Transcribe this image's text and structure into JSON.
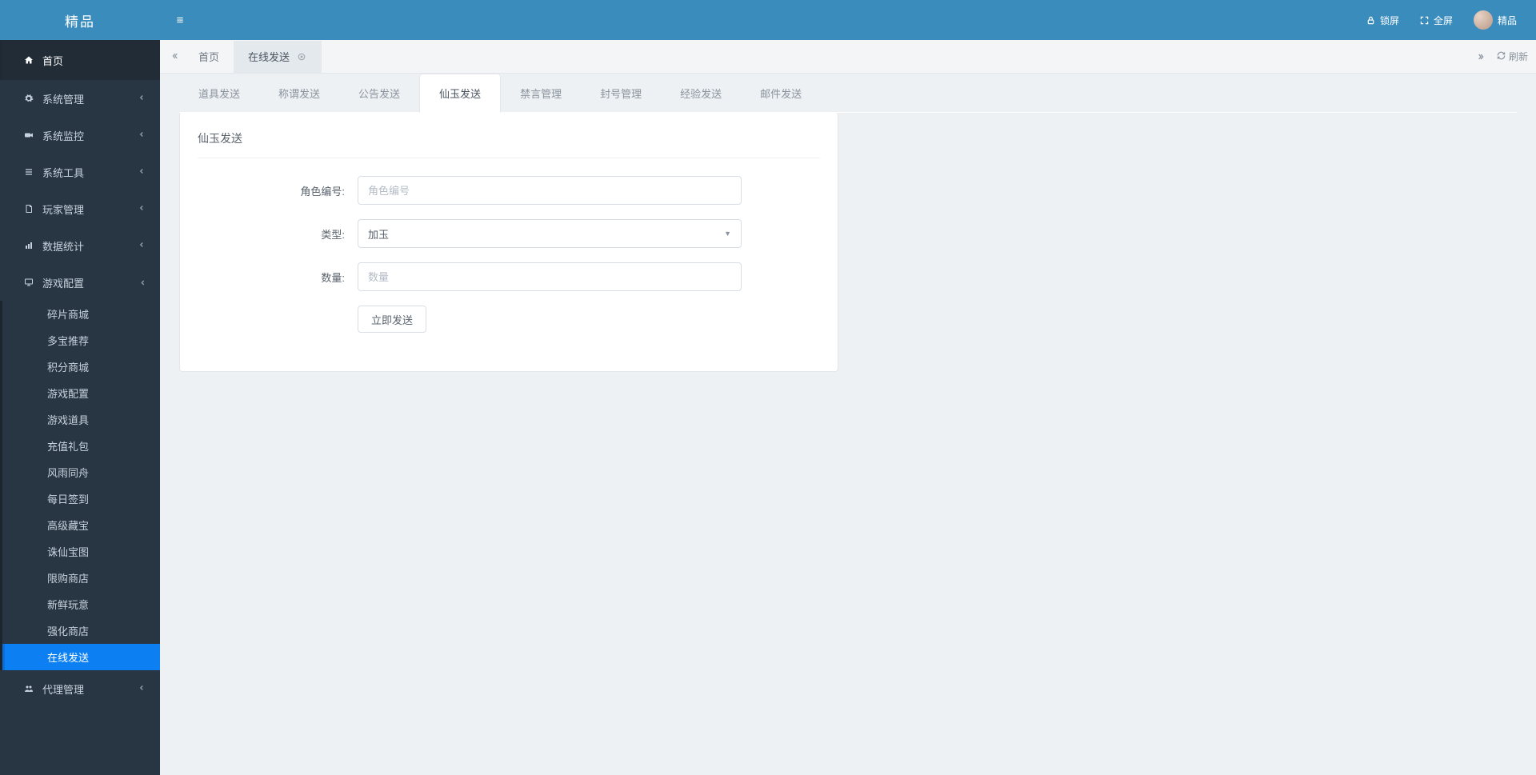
{
  "brand": "精品",
  "topbar": {
    "lock_label": "锁屏",
    "fullscreen_label": "全屏",
    "user_name": "精品"
  },
  "sidebar": {
    "home": "首页",
    "groups": [
      {
        "icon": "gear",
        "label": "系统管理"
      },
      {
        "icon": "camera",
        "label": "系统监控"
      },
      {
        "icon": "list",
        "label": "系统工具"
      },
      {
        "icon": "file",
        "label": "玩家管理"
      },
      {
        "icon": "chart",
        "label": "数据统计"
      }
    ],
    "game_group": {
      "icon": "monitor",
      "label": "游戏配置"
    },
    "game_sub": [
      "碎片商城",
      "多宝推荐",
      "积分商城",
      "游戏配置",
      "游戏道具",
      "充值礼包",
      "风雨同舟",
      "每日签到",
      "高级藏宝",
      "诛仙宝图",
      "限购商店",
      "新鲜玩意",
      "强化商店",
      "在线发送"
    ],
    "game_sub_active_index": 13,
    "agent_group": {
      "icon": "users",
      "label": "代理管理"
    }
  },
  "tabs": {
    "items": [
      {
        "label": "首页",
        "closable": false
      },
      {
        "label": "在线发送",
        "closable": true
      }
    ],
    "current_index": 1,
    "refresh_label": "刷新"
  },
  "feature_tabs": {
    "items": [
      "道具发送",
      "称谓发送",
      "公告发送",
      "仙玉发送",
      "禁言管理",
      "封号管理",
      "经验发送",
      "邮件发送"
    ],
    "active_index": 3
  },
  "form": {
    "title": "仙玉发送",
    "role_label": "角色编号:",
    "role_placeholder": "角色编号",
    "type_label": "类型:",
    "type_selected": "加玉",
    "qty_label": "数量:",
    "qty_placeholder": "数量",
    "submit_label": "立即发送"
  }
}
